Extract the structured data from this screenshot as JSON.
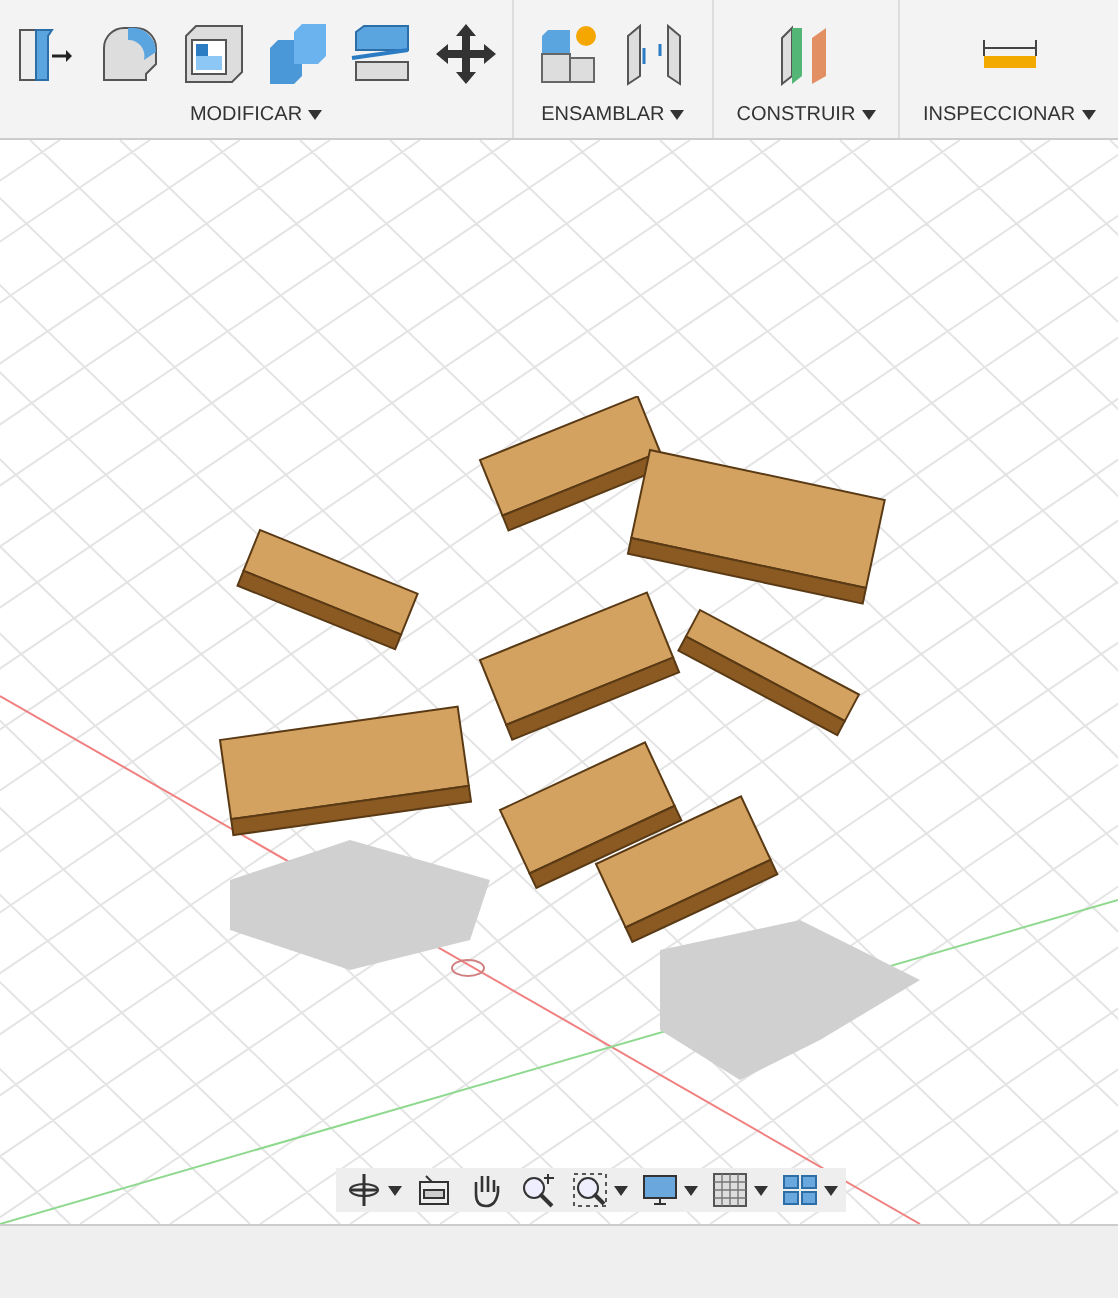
{
  "toolbar_groups": [
    {
      "label": "MODIFICAR",
      "tools": [
        {
          "kind": "press-pull"
        },
        {
          "kind": "fillet"
        },
        {
          "kind": "shell"
        },
        {
          "kind": "combine"
        },
        {
          "kind": "split"
        },
        {
          "kind": "move"
        }
      ]
    },
    {
      "label": "ENSAMBLAR",
      "tools": [
        {
          "kind": "new-component"
        },
        {
          "kind": "joint"
        }
      ]
    },
    {
      "label": "CONSTRUIR",
      "tools": [
        {
          "kind": "plane"
        }
      ]
    },
    {
      "label": "INSPECCIONAR",
      "tools": [
        {
          "kind": "measure"
        }
      ]
    }
  ],
  "nav_tools": [
    {
      "kind": "orbit",
      "has_menu": true
    },
    {
      "kind": "look-at",
      "has_menu": false
    },
    {
      "kind": "pan",
      "has_menu": false
    },
    {
      "kind": "zoom",
      "has_menu": false
    },
    {
      "kind": "fit",
      "has_menu": true
    },
    {
      "kind": "display",
      "has_menu": true
    },
    {
      "kind": "grid",
      "has_menu": true
    },
    {
      "kind": "viewports",
      "has_menu": true
    }
  ]
}
